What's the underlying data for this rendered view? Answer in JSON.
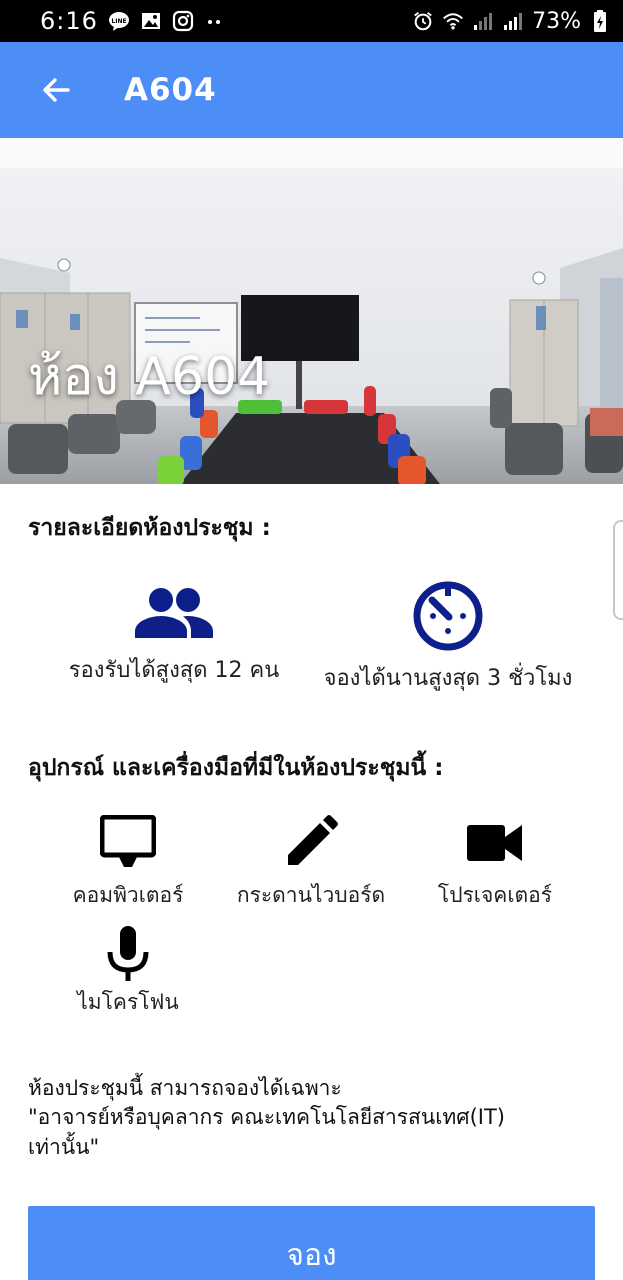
{
  "status_bar": {
    "time": "6:16",
    "left_icons": [
      "line-icon",
      "gallery-icon",
      "instagram-icon",
      "more-dots-icon"
    ],
    "right_icons": [
      "alarm-icon",
      "wifi-icon",
      "signal-icon",
      "signal-icon",
      "battery-icon"
    ],
    "battery_percent": "73%"
  },
  "app_bar": {
    "title": "A604",
    "background_color": "#4d8ef6"
  },
  "hero": {
    "title": "ห้อง A604"
  },
  "details": {
    "heading": "รายละเอียดห้องประชุม :",
    "capacity": {
      "icon": "people-icon",
      "label": "รองรับได้สูงสุด 12 คน"
    },
    "duration": {
      "icon": "timer-icon",
      "label": "จองได้นานสูงสุด 3 ชั่วโมง"
    },
    "icon_color": "#0d1f8a"
  },
  "equipment": {
    "heading": "อุปกรณ์ และเครื่องมือที่มีในห้องประชุมนี้ :",
    "items": [
      {
        "icon": "monitor-icon",
        "label": "คอมพิวเตอร์"
      },
      {
        "icon": "pencil-icon",
        "label": "กระดานไวบอร์ด"
      },
      {
        "icon": "video-camera-icon",
        "label": "โปรเจคเตอร์"
      },
      {
        "icon": "microphone-icon",
        "label": "ไมโครโฟน"
      }
    ]
  },
  "note": {
    "line1": "ห้องประชุมนี้ สามารถจองได้เฉพาะ",
    "line2": "\"อาจารย์หรือบุคลากร คณะเทคโนโลยีสารสนเทศ(IT)",
    "line3": "เท่านั้น\""
  },
  "actions": {
    "book_label": "จอง"
  }
}
